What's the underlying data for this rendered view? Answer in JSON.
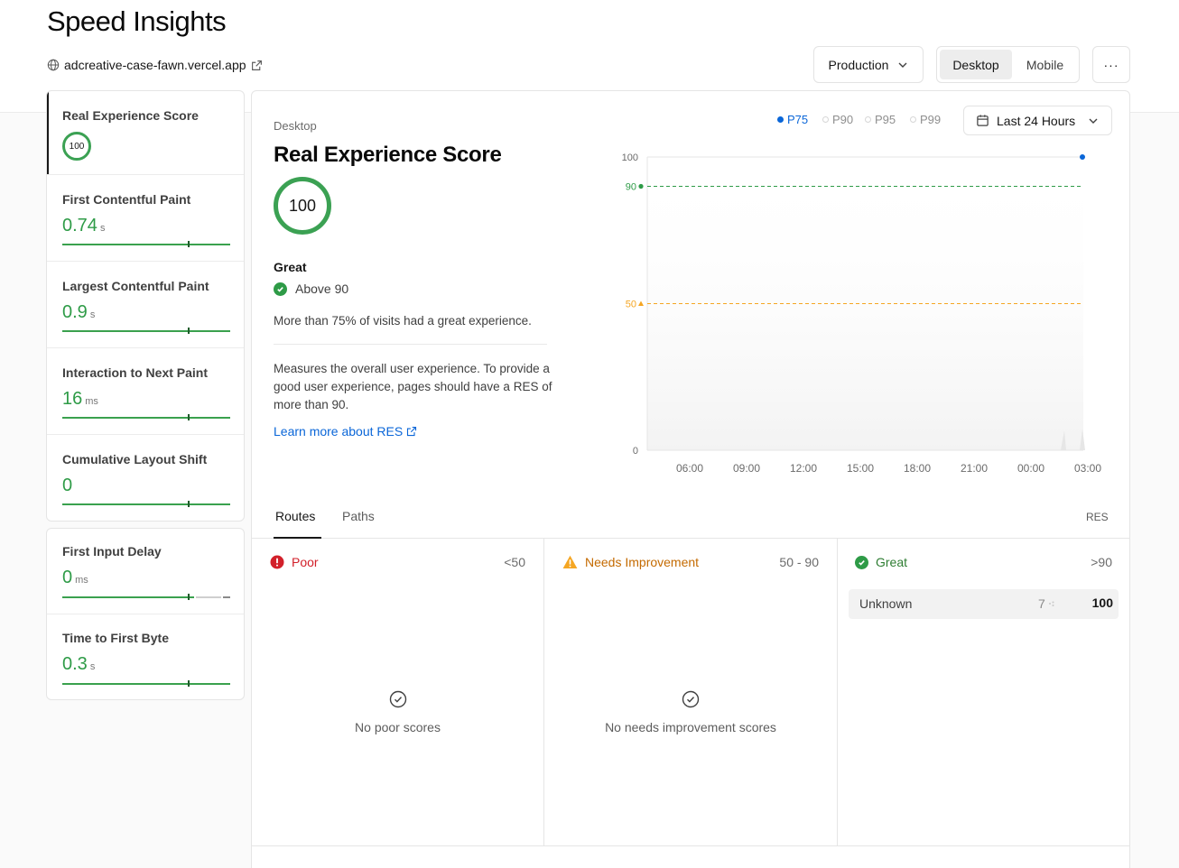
{
  "page": {
    "title": "Speed Insights",
    "site_url": "adcreative-case-fawn.vercel.app"
  },
  "header": {
    "environment": "Production",
    "device_options": [
      "Desktop",
      "Mobile"
    ],
    "device_selected": "Desktop",
    "more_label": "···"
  },
  "sidebar": {
    "res": {
      "label": "Real Experience Score",
      "value": "100"
    },
    "metrics": [
      {
        "label": "First Contentful Paint",
        "value": "0.74",
        "unit": "s"
      },
      {
        "label": "Largest Contentful Paint",
        "value": "0.9",
        "unit": "s"
      },
      {
        "label": "Interaction to Next Paint",
        "value": "16",
        "unit": "ms"
      },
      {
        "label": "Cumulative Layout Shift",
        "value": "0",
        "unit": ""
      }
    ],
    "legacy_metrics": [
      {
        "label": "First Input Delay",
        "value": "0",
        "unit": "ms"
      },
      {
        "label": "Time to First Byte",
        "value": "0.3",
        "unit": "s"
      }
    ]
  },
  "detail": {
    "device": "Desktop",
    "title": "Real Experience Score",
    "score": "100",
    "rating": "Great",
    "rating_threshold": "Above 90",
    "summary": "More than 75% of visits had a great experience.",
    "description": "Measures the overall user experience. To provide a good user experience, pages should have a RES of more than 90.",
    "learn_more": "Learn more about RES"
  },
  "chart_controls": {
    "percentiles": [
      "P75",
      "P90",
      "P95",
      "P99"
    ],
    "selected_percentile": "P75",
    "time_range": "Last 24 Hours"
  },
  "chart_data": {
    "type": "line",
    "x_ticks": [
      "06:00",
      "09:00",
      "12:00",
      "15:00",
      "18:00",
      "21:00",
      "00:00",
      "03:00"
    ],
    "y_ticks": [
      "0",
      "50",
      "90",
      "100"
    ],
    "ylim": [
      0,
      100
    ],
    "thresholds": [
      {
        "value": 90,
        "label": "90",
        "color": "#2e9b47"
      },
      {
        "value": 50,
        "label": "50",
        "color": "#f5a623"
      }
    ],
    "series": [
      {
        "values": [
          100
        ],
        "color": "#0a66d8"
      }
    ]
  },
  "routes": {
    "tabs": [
      "Routes",
      "Paths"
    ],
    "active_tab": "Routes",
    "metric_label": "RES",
    "columns": [
      {
        "status": "Poor",
        "range": "<50",
        "empty_text": "No poor scores",
        "color": "#d2202a"
      },
      {
        "status": "Needs Improvement",
        "range": "50 - 90",
        "empty_text": "No needs improvement scores",
        "color": "#c46a00"
      },
      {
        "status": "Great",
        "range": ">90",
        "color": "#2e7d32"
      }
    ],
    "great_rows": [
      {
        "route": "Unknown",
        "count": "7",
        "score": "100"
      }
    ]
  },
  "colors": {
    "good": "#2e9b47",
    "accent": "#0a66d8",
    "warning": "#f5a623",
    "poor": "#d2202a"
  }
}
